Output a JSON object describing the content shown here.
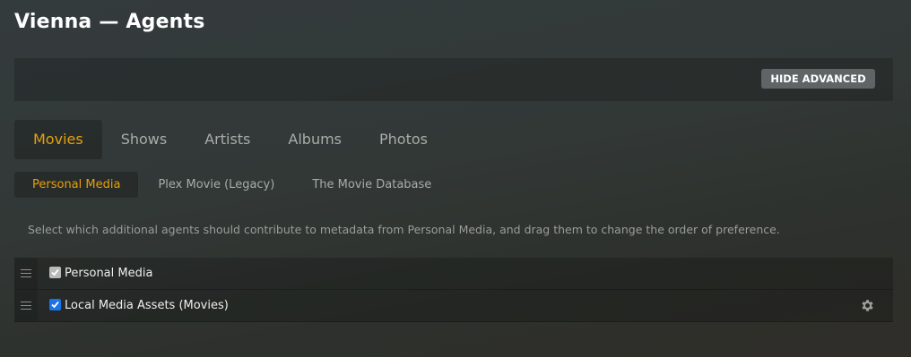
{
  "header": {
    "title": "Vienna — Agents"
  },
  "advanced": {
    "hide_label": "HIDE ADVANCED"
  },
  "type_tabs": [
    {
      "label": "Movies",
      "active": true
    },
    {
      "label": "Shows",
      "active": false
    },
    {
      "label": "Artists",
      "active": false
    },
    {
      "label": "Albums",
      "active": false
    },
    {
      "label": "Photos",
      "active": false
    }
  ],
  "agent_tabs": [
    {
      "label": "Personal Media",
      "active": true
    },
    {
      "label": "Plex Movie (Legacy)",
      "active": false
    },
    {
      "label": "The Movie Database",
      "active": false
    }
  ],
  "description": "Select which additional agents should contribute to metadata from Personal Media, and drag them to change the order of preference.",
  "agents": [
    {
      "label": "Personal Media",
      "checked": true,
      "disabled": true,
      "icon_handle": "drag-handle-icon"
    },
    {
      "label": "Local Media Assets (Movies)",
      "checked": true,
      "disabled": false,
      "icon_handle": "drag-handle-icon",
      "settings_icon": "gear-icon"
    }
  ],
  "colors": {
    "accent": "#e5a00d",
    "checkbox": "#1a73e8",
    "button_bg": "#5f6466"
  }
}
